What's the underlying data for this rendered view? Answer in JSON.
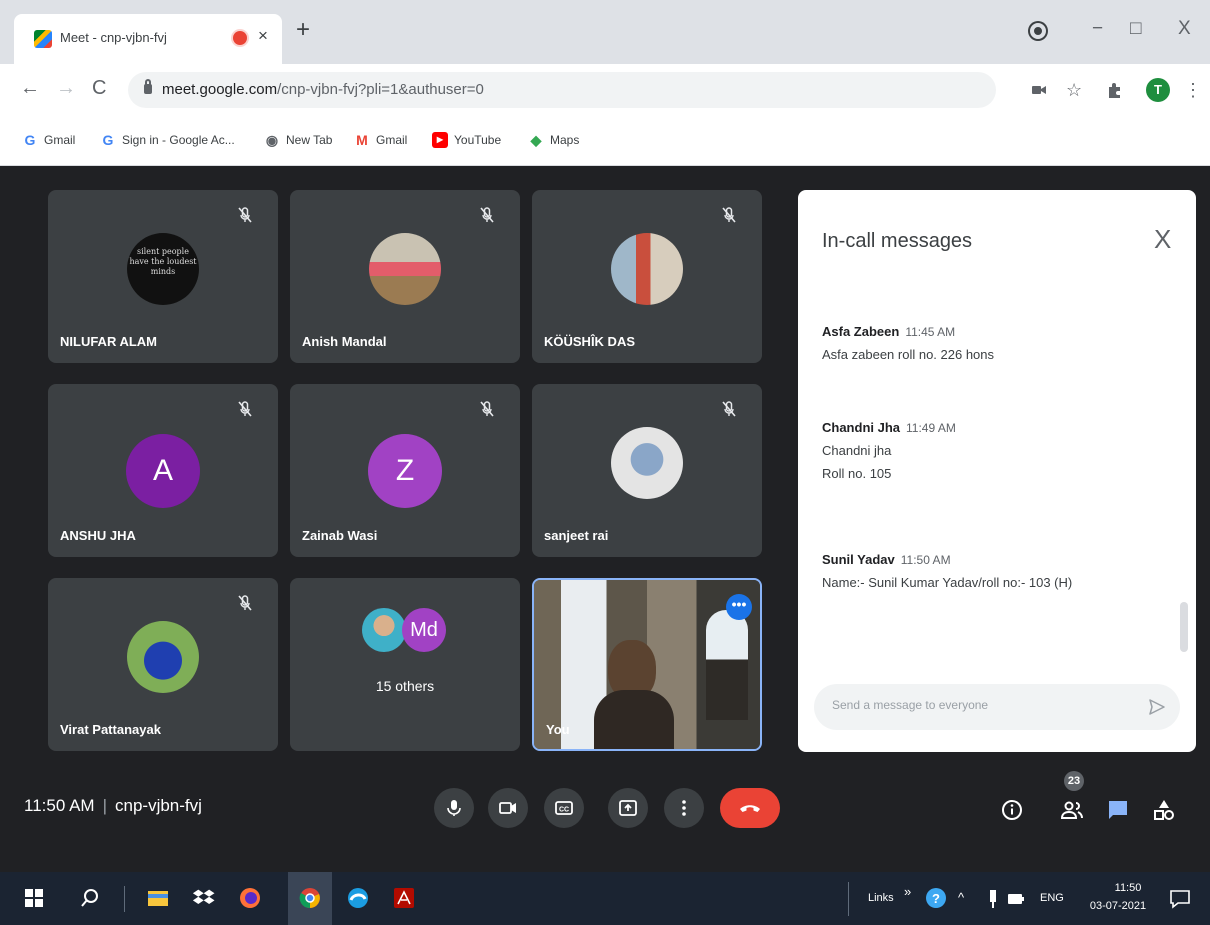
{
  "browser": {
    "tab_title": "Meet - cnp-vjbn-fvj",
    "tab_close": "×",
    "new_tab": "+",
    "window_controls": {
      "minimize": "−",
      "maximize": "□",
      "close": "X"
    },
    "url_host": "meet.google.com",
    "url_path": "/cnp-vjbn-fvj?pli=1&authuser=0",
    "account_initial": "T",
    "bookmarks": [
      {
        "label": "Gmail",
        "icon": "google-g-icon"
      },
      {
        "label": "Sign in - Google Ac...",
        "icon": "google-g-icon"
      },
      {
        "label": "New Tab",
        "icon": "chrome-icon"
      },
      {
        "label": "Gmail",
        "icon": "gmail-m-icon"
      },
      {
        "label": "YouTube",
        "icon": "youtube-icon"
      },
      {
        "label": "Maps",
        "icon": "maps-icon"
      }
    ]
  },
  "participants": [
    {
      "name": "NILUFAR ALAM",
      "avatar": "photo",
      "photo_text": "silent people have the loudest minds",
      "muted": true
    },
    {
      "name": "Anish Mandal",
      "avatar": "photo",
      "muted": true
    },
    {
      "name": "KÖÜSHÎK DAS",
      "avatar": "photo",
      "muted": true
    },
    {
      "name": "ANSHU JHA",
      "avatar": "letter",
      "letter": "A",
      "color": "#7b1fa2",
      "muted": true
    },
    {
      "name": "Zainab Wasi",
      "avatar": "letter",
      "letter": "Z",
      "color": "#a142c4",
      "muted": true
    },
    {
      "name": "sanjeet rai",
      "avatar": "photo",
      "muted": true
    },
    {
      "name": "Virat Pattanayak",
      "avatar": "photo",
      "muted": true
    },
    {
      "name": "15 others",
      "avatar": "group",
      "letter": "Md",
      "color": "#a142c4",
      "muted": false
    },
    {
      "name": "You",
      "avatar": "camera",
      "muted": false
    }
  ],
  "chat": {
    "title": "In-call messages",
    "close": "X",
    "messages": [
      {
        "sender": "Asfa Zabeen",
        "time": "11:45 AM",
        "lines": [
          "Asfa zabeen roll no. 226 hons"
        ]
      },
      {
        "sender": "Chandni Jha",
        "time": "11:49 AM",
        "lines": [
          "Chandni jha",
          "Roll no. 105"
        ]
      },
      {
        "sender": "Sunil Yadav",
        "time": "11:50 AM",
        "lines": [
          "Name:- Sunil Kumar Yadav/roll no:- 103 (H)"
        ]
      }
    ],
    "input_placeholder": "Send a message to everyone"
  },
  "meeting": {
    "time": "11:50 AM",
    "separator": "|",
    "code": "cnp-vjbn-fvj",
    "people_count": "23",
    "more_dots": "•••"
  },
  "taskbar": {
    "links_label": "Links",
    "links_chevron": "»",
    "lang": "ENG",
    "clock_time": "11:50",
    "clock_date": "03-07-2021",
    "tray_caret": "^"
  },
  "colors": {
    "meet_bg": "#202124",
    "tile_bg": "#3c4043",
    "end_call": "#ea4335",
    "accent": "#1a73e8",
    "chat_icon": "#8ab4f8"
  }
}
